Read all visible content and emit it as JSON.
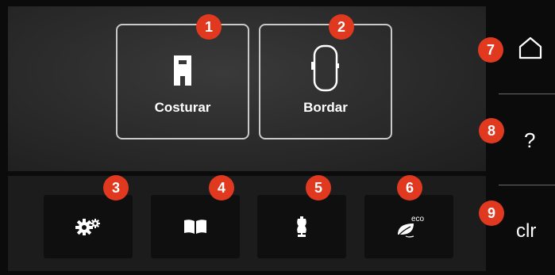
{
  "mode_tiles": [
    {
      "label": "Costurar",
      "badge": "1",
      "icon": "presser-foot-icon"
    },
    {
      "label": "Bordar",
      "badge": "2",
      "icon": "embroidery-hoop-icon"
    }
  ],
  "tool_buttons": [
    {
      "badge": "3",
      "icon": "gears-icon"
    },
    {
      "badge": "4",
      "icon": "open-book-icon"
    },
    {
      "badge": "5",
      "icon": "dress-form-icon"
    },
    {
      "badge": "6",
      "icon": "eco-leaf-icon",
      "icon_text": "eco"
    }
  ],
  "side_buttons": {
    "home": {
      "badge": "7",
      "icon": "home-icon"
    },
    "help": {
      "badge": "8",
      "label": "?"
    },
    "clear": {
      "badge": "9",
      "label": "clr"
    }
  },
  "colors": {
    "badge": "#e0391f",
    "background": "#0b0b0b",
    "tile_border": "#c9c9c9"
  }
}
